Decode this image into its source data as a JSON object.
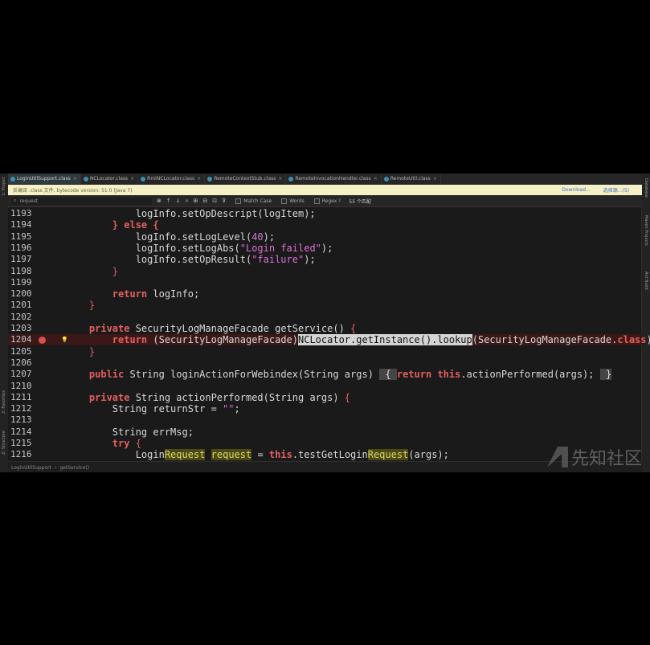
{
  "tabs": [
    {
      "label": "LoginUtilSupport.class",
      "active": true
    },
    {
      "label": "NCLocator.class",
      "active": false
    },
    {
      "label": "RmiNCLocator.class",
      "active": false
    },
    {
      "label": "RemoteContextStub.class",
      "active": false
    },
    {
      "label": "RemoteInvocationHandler.class",
      "active": false
    },
    {
      "label": "RemoteUtil.class",
      "active": false
    }
  ],
  "banner": {
    "message": "反编译 .class 文件, bytecode version: 51.0 (Java 7)",
    "download_label": "Download...",
    "choose_source_label": "选择源...(5)"
  },
  "search": {
    "query": "request",
    "match_case_label": "Match Case",
    "words_label": "Words",
    "regex_label": "Regex",
    "regex_help": "?",
    "matches": "55 个匹配"
  },
  "left_strip": {
    "project_label": "1: Project",
    "favorites_label": "2: Favorites",
    "structure_label": "Z: Structure"
  },
  "right_strip": {
    "database_label": "Database",
    "maven_label": "Maven Projects",
    "ant_label": "Ant Build"
  },
  "editor": {
    "lines": [
      {
        "num": "1193",
        "parts": [
          {
            "t": "            logInfo.setOpDescript(logItem);",
            "c": "fld"
          }
        ]
      },
      {
        "num": "1194",
        "parts": [
          {
            "t": "        ",
            "c": ""
          },
          {
            "t": "} else {",
            "c": "kw"
          }
        ]
      },
      {
        "num": "1195",
        "parts": [
          {
            "t": "            logInfo.setLogLevel(",
            "c": ""
          },
          {
            "t": "40",
            "c": "nm"
          },
          {
            "t": ");",
            "c": ""
          }
        ]
      },
      {
        "num": "1196",
        "parts": [
          {
            "t": "            logInfo.setLogAbs(",
            "c": ""
          },
          {
            "t": "\"Login failed\"",
            "c": "st"
          },
          {
            "t": ");",
            "c": ""
          }
        ]
      },
      {
        "num": "1197",
        "parts": [
          {
            "t": "            logInfo.setOpResult(",
            "c": ""
          },
          {
            "t": "\"failure\"",
            "c": "st"
          },
          {
            "t": ");",
            "c": ""
          }
        ]
      },
      {
        "num": "1198",
        "parts": [
          {
            "t": "        ",
            "c": ""
          },
          {
            "t": "}",
            "c": "br"
          }
        ]
      },
      {
        "num": "1199",
        "parts": []
      },
      {
        "num": "1200",
        "parts": [
          {
            "t": "        ",
            "c": ""
          },
          {
            "t": "return",
            "c": "kw"
          },
          {
            "t": " logInfo;",
            "c": ""
          }
        ]
      },
      {
        "num": "1201",
        "parts": [
          {
            "t": "    ",
            "c": ""
          },
          {
            "t": "}",
            "c": "br"
          }
        ]
      },
      {
        "num": "1202",
        "parts": []
      },
      {
        "num": "1203",
        "parts": [
          {
            "t": "    ",
            "c": ""
          },
          {
            "t": "private",
            "c": "kw"
          },
          {
            "t": " SecurityLogManageFacade getService() ",
            "c": ""
          },
          {
            "t": "{",
            "c": "br"
          }
        ]
      },
      {
        "num": "1204",
        "highlight": true,
        "breakpoint": true,
        "parts": [
          {
            "t": "        ",
            "c": ""
          },
          {
            "t": "return",
            "c": "kw"
          },
          {
            "t": " (SecurityLogManageFacade)",
            "c": ""
          },
          {
            "t": "NCLocator.getInstance().lookup",
            "c": "sel"
          },
          {
            "t": "(SecurityLogManageFacade.",
            "c": ""
          },
          {
            "t": "class",
            "c": "kw"
          },
          {
            "t": ");",
            "c": ""
          }
        ]
      },
      {
        "num": "1205",
        "parts": [
          {
            "t": "    ",
            "c": ""
          },
          {
            "t": "}",
            "c": "br"
          }
        ]
      },
      {
        "num": "1206",
        "parts": []
      },
      {
        "num": "1207",
        "parts": [
          {
            "t": "    ",
            "c": ""
          },
          {
            "t": "public",
            "c": "kw"
          },
          {
            "t": " String loginActionForWebindex(String args) ",
            "c": ""
          },
          {
            "t": " { ",
            "c": "blk"
          },
          {
            "t": "return",
            "c": "kw"
          },
          {
            "t": " ",
            "c": ""
          },
          {
            "t": "this",
            "c": "kw"
          },
          {
            "t": ".actionPerformed(args); ",
            "c": ""
          },
          {
            "t": " }",
            "c": "blk"
          }
        ]
      },
      {
        "num": "1210",
        "parts": []
      },
      {
        "num": "1211",
        "parts": [
          {
            "t": "    ",
            "c": ""
          },
          {
            "t": "private",
            "c": "kw"
          },
          {
            "t": " String actionPerformed(String args) ",
            "c": ""
          },
          {
            "t": "{",
            "c": "br"
          }
        ]
      },
      {
        "num": "1212",
        "parts": [
          {
            "t": "        String returnStr = ",
            "c": ""
          },
          {
            "t": "\"\"",
            "c": "st"
          },
          {
            "t": ";",
            "c": ""
          }
        ]
      },
      {
        "num": "1213",
        "parts": []
      },
      {
        "num": "1214",
        "parts": [
          {
            "t": "        String errMsg;",
            "c": ""
          }
        ]
      },
      {
        "num": "1215",
        "parts": [
          {
            "t": "        ",
            "c": ""
          },
          {
            "t": "try",
            "c": "kw"
          },
          {
            "t": " ",
            "c": ""
          },
          {
            "t": "{",
            "c": "br"
          }
        ]
      },
      {
        "num": "1216",
        "parts": [
          {
            "t": "            Login",
            "c": ""
          },
          {
            "t": "Request",
            "c": "mt"
          },
          {
            "t": " ",
            "c": ""
          },
          {
            "t": "request",
            "c": "mt"
          },
          {
            "t": " = ",
            "c": ""
          },
          {
            "t": "this",
            "c": "kw"
          },
          {
            "t": ".testGetLogin",
            "c": ""
          },
          {
            "t": "Request",
            "c": "mt"
          },
          {
            "t": "(args);",
            "c": ""
          }
        ]
      }
    ]
  },
  "breadcrumb": {
    "class_label": "LoginUtilSupport",
    "method_label": "getService()"
  },
  "watermark": {
    "text": "先知社区"
  }
}
